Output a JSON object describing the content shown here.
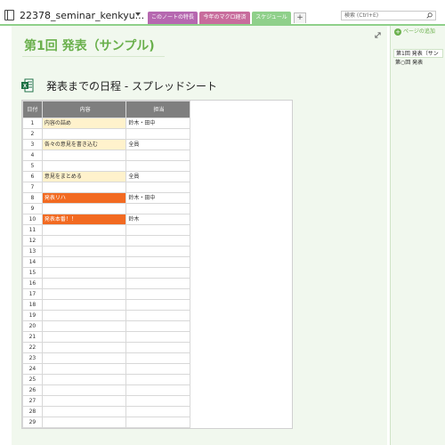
{
  "header": {
    "notebook_title": "22378_seminar_kenkyu...",
    "tabs": [
      {
        "label": "このノートの特長",
        "color": "#b668b0"
      },
      {
        "label": "今年のマクロ経済",
        "color": "#c86c9c"
      },
      {
        "label": "スケジュール",
        "color": "#8fd08a"
      }
    ],
    "add_tab_label": "+",
    "search_placeholder": "検索 (Ctrl+E)"
  },
  "page": {
    "title": "第1回 発表（サンプル)",
    "embed_title": "発表までの日程 - スプレッドシート"
  },
  "sheet": {
    "headers": [
      "日付",
      "内容",
      "担当"
    ],
    "rows": [
      {
        "n": "1",
        "content": "内容の詰め",
        "owner": "鈴木・田中",
        "style": "hl-yellow"
      },
      {
        "n": "2",
        "content": "",
        "owner": "",
        "style": ""
      },
      {
        "n": "3",
        "content": "各々の意見を書き込む",
        "owner": "全員",
        "style": "hl-yellow"
      },
      {
        "n": "4",
        "content": "",
        "owner": "",
        "style": ""
      },
      {
        "n": "5",
        "content": "",
        "owner": "",
        "style": ""
      },
      {
        "n": "6",
        "content": "意見をまとめる",
        "owner": "全員",
        "style": "hl-yellow"
      },
      {
        "n": "7",
        "content": "",
        "owner": "",
        "style": ""
      },
      {
        "n": "8",
        "content": "発表リハ",
        "owner": "鈴木・田中",
        "style": "hl-orange"
      },
      {
        "n": "9",
        "content": "",
        "owner": "",
        "style": ""
      },
      {
        "n": "10",
        "content": "発表本番！！",
        "owner": "鈴木",
        "style": "hl-orange"
      },
      {
        "n": "11",
        "content": "",
        "owner": "",
        "style": ""
      },
      {
        "n": "12",
        "content": "",
        "owner": "",
        "style": ""
      },
      {
        "n": "13",
        "content": "",
        "owner": "",
        "style": ""
      },
      {
        "n": "14",
        "content": "",
        "owner": "",
        "style": ""
      },
      {
        "n": "15",
        "content": "",
        "owner": "",
        "style": ""
      },
      {
        "n": "16",
        "content": "",
        "owner": "",
        "style": ""
      },
      {
        "n": "17",
        "content": "",
        "owner": "",
        "style": ""
      },
      {
        "n": "18",
        "content": "",
        "owner": "",
        "style": ""
      },
      {
        "n": "19",
        "content": "",
        "owner": "",
        "style": ""
      },
      {
        "n": "20",
        "content": "",
        "owner": "",
        "style": ""
      },
      {
        "n": "21",
        "content": "",
        "owner": "",
        "style": ""
      },
      {
        "n": "22",
        "content": "",
        "owner": "",
        "style": ""
      },
      {
        "n": "23",
        "content": "",
        "owner": "",
        "style": ""
      },
      {
        "n": "24",
        "content": "",
        "owner": "",
        "style": ""
      },
      {
        "n": "25",
        "content": "",
        "owner": "",
        "style": ""
      },
      {
        "n": "26",
        "content": "",
        "owner": "",
        "style": ""
      },
      {
        "n": "27",
        "content": "",
        "owner": "",
        "style": ""
      },
      {
        "n": "28",
        "content": "",
        "owner": "",
        "style": ""
      },
      {
        "n": "29",
        "content": "",
        "owner": "",
        "style": ""
      }
    ]
  },
  "sidebar": {
    "add_page_label": "ページの追加",
    "pages": [
      {
        "label": "第1回 発表（サン"
      },
      {
        "label": "第○回 発表"
      }
    ]
  },
  "colors": {
    "accent_green": "#6ab04c",
    "highlight_yellow": "#fff2cc",
    "highlight_orange": "#f26a21"
  }
}
